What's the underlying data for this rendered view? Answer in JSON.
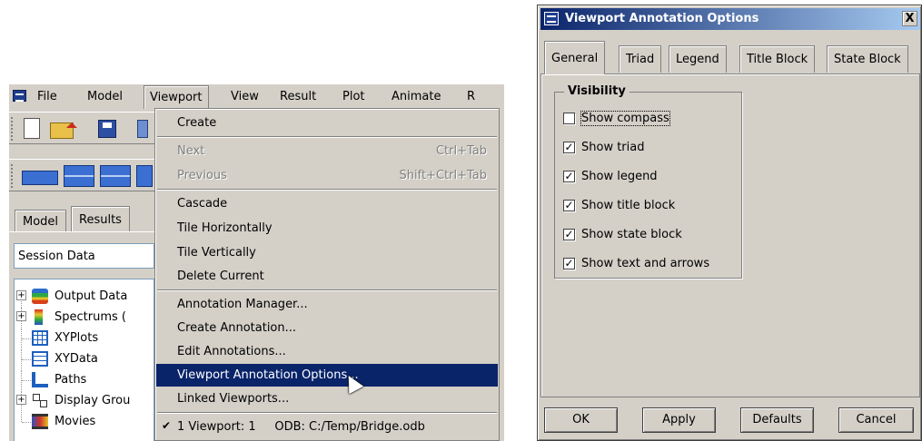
{
  "menubar": {
    "items": [
      "File",
      "Model",
      "Viewport",
      "View",
      "Result",
      "Plot",
      "Animate",
      "R"
    ]
  },
  "left_tabs": [
    "Model",
    "Results"
  ],
  "session_select": {
    "value": "Session Data"
  },
  "tree": [
    {
      "label": "Output Data",
      "icon": "output-database-icon",
      "expand": "+"
    },
    {
      "label": "Spectrums (",
      "icon": "spectrum-icon",
      "expand": "+"
    },
    {
      "label": "XYPlots",
      "icon": "xyplot-icon",
      "expand": ""
    },
    {
      "label": "XYData",
      "icon": "xydata-icon",
      "expand": ""
    },
    {
      "label": "Paths",
      "icon": "paths-icon",
      "expand": ""
    },
    {
      "label": "Display Grou",
      "icon": "display-group-icon",
      "expand": "+"
    },
    {
      "label": "Movies",
      "icon": "movies-icon",
      "expand": ""
    }
  ],
  "viewport_menu": {
    "items": [
      {
        "label": "Create",
        "shortcut": "",
        "disabled": false
      },
      {
        "label": "Next",
        "shortcut": "Ctrl+Tab",
        "disabled": true
      },
      {
        "label": "Previous",
        "shortcut": "Shift+Ctrl+Tab",
        "disabled": true
      },
      {
        "label": "Cascade",
        "shortcut": "",
        "disabled": false
      },
      {
        "label": "Tile Horizontally",
        "shortcut": "",
        "disabled": false
      },
      {
        "label": "Tile Vertically",
        "shortcut": "",
        "disabled": false
      },
      {
        "label": "Delete Current",
        "shortcut": "",
        "disabled": false
      },
      {
        "label": "Annotation Manager...",
        "shortcut": "",
        "disabled": false
      },
      {
        "label": "Create Annotation...",
        "shortcut": "",
        "disabled": false
      },
      {
        "label": "Edit Annotations...",
        "shortcut": "",
        "disabled": false
      },
      {
        "label": "Viewport Annotation Options...",
        "shortcut": "",
        "disabled": false,
        "highlighted": true
      },
      {
        "label": "Linked Viewports...",
        "shortcut": "",
        "disabled": false
      },
      {
        "label": "1 Viewport: 1     ODB: C:/Temp/Bridge.odb",
        "shortcut": "",
        "disabled": false,
        "checked": true
      }
    ]
  },
  "dialog": {
    "title": "Viewport Annotation Options",
    "close_glyph": "X",
    "tabs": [
      "General",
      "Triad",
      "Legend",
      "Title Block",
      "State Block"
    ],
    "active_tab": "General",
    "group_label": "Visibility",
    "checkboxes": [
      {
        "label": "Show compass",
        "checked": false
      },
      {
        "label": "Show triad",
        "checked": true
      },
      {
        "label": "Show legend",
        "checked": true
      },
      {
        "label": "Show title block",
        "checked": true
      },
      {
        "label": "Show state block",
        "checked": true
      },
      {
        "label": "Show text and arrows",
        "checked": true
      }
    ],
    "buttons": {
      "ok": "OK",
      "apply": "Apply",
      "defaults": "Defaults",
      "cancel": "Cancel"
    }
  },
  "colors": {
    "menu_highlight": "#0a246a",
    "title_start": "#0a246a",
    "title_end": "#a6caf0",
    "face": "#d4d0c8"
  }
}
